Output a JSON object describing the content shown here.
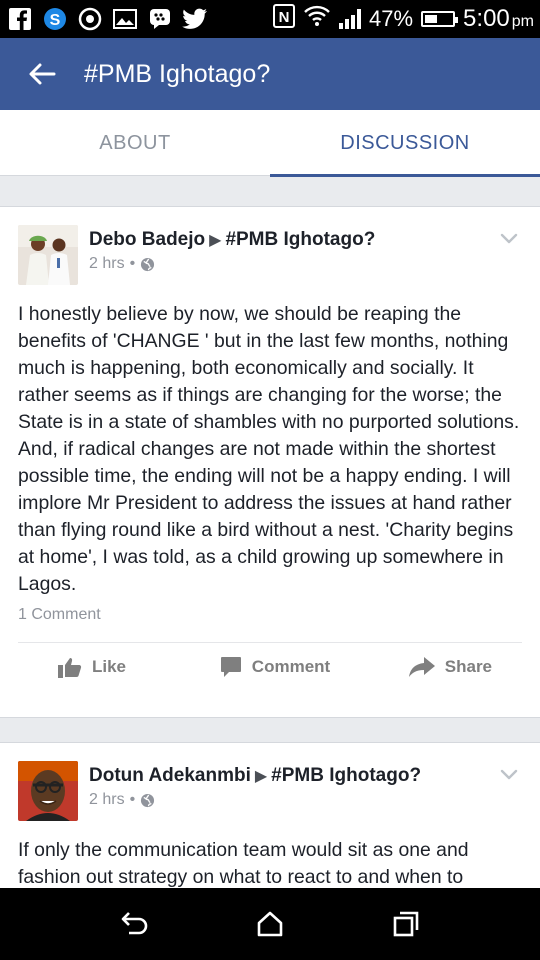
{
  "status_bar": {
    "battery": "47%",
    "battery_level": 0.47,
    "time": "5:00",
    "ampm": "pm",
    "notification_icons": [
      "facebook-icon",
      "skype-icon",
      "circle-app-icon",
      "gallery-icon",
      "bbm-icon",
      "twitter-icon"
    ]
  },
  "app_bar": {
    "title": "#PMB Ighotago?",
    "color": "#3b5998"
  },
  "tabs": [
    {
      "label": "ABOUT",
      "active": false
    },
    {
      "label": "DISCUSSION",
      "active": true
    }
  ],
  "posts": [
    {
      "author": "Debo Badejo",
      "group": "#PMB Ighotago?",
      "time": "2 hrs",
      "text": "I honestly believe by now, we should be reaping the benefits of 'CHANGE ' but in the last few months, nothing much is happening, both economically and socially. It rather seems as if things are changing for the worse; the State is in a state of shambles with no purported solutions. And, if radical changes are not made within the shortest possible time, the ending will not be a happy ending. I will implore Mr President to address the  issues at hand rather than flying round like a bird without a nest. 'Charity begins at home', I was told,  as a child growing up somewhere in Lagos.",
      "comments": "1 Comment"
    },
    {
      "author": "Dotun Adekanmbi",
      "group": "#PMB Ighotago?",
      "time": "2 hrs",
      "text": "If only the communication team would sit as one and fashion out strategy on what to react to and when to"
    }
  ],
  "actions": {
    "like": "Like",
    "comment": "Comment",
    "share": "Share"
  }
}
